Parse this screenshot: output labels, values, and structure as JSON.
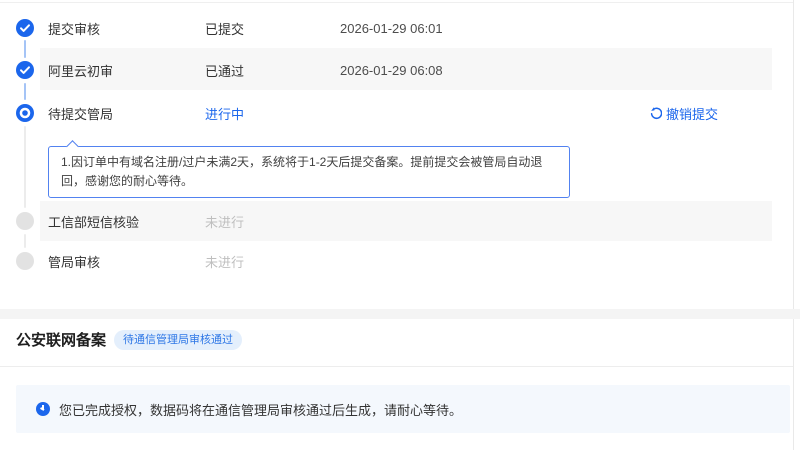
{
  "colors": {
    "accent_blue": "#1b66ec",
    "link_blue": "#2e77e6",
    "connector_blue": "#a5c4f6",
    "connector_gray": "#ececec",
    "row_alt_bg": "#f7f7f7",
    "pending_icon_gray": "#e2e2e2",
    "pending_text_gray": "#bfbfbf",
    "tooltip_border": "#5282f0",
    "badge_bg": "#e4effc",
    "info_bar_bg": "#f4f8fd"
  },
  "timeline": {
    "steps": [
      {
        "label": "提交审核",
        "status": "已提交",
        "time": "2026-01-29 06:01",
        "state": "done",
        "icon": "check-circle-icon"
      },
      {
        "label": "阿里云初审",
        "status": "已通过",
        "time": "2026-01-29 06:08",
        "state": "done",
        "icon": "check-circle-icon"
      },
      {
        "label": "待提交管局",
        "status": "进行中",
        "time": "",
        "state": "current",
        "icon": "radio-circle-icon",
        "action_label": "撤销提交",
        "action_icon": "undo-icon"
      },
      {
        "label": "工信部短信核验",
        "status": "未进行",
        "time": "",
        "state": "pending",
        "icon": "gray-dot-icon"
      },
      {
        "label": "管局审核",
        "status": "未进行",
        "time": "",
        "state": "pending",
        "icon": "gray-dot-icon"
      }
    ],
    "notice": "1.因订单中有域名注册/过户未满2天，系统将于1-2天后提交备案。提前提交会被管局自动退回，感谢您的耐心等待。"
  },
  "police_filing": {
    "title": "公安联网备案",
    "badge": "待通信管理局审核通过",
    "notice": "您已完成授权，数据码将在通信管理局审核通过后生成，请耐心等待。",
    "icon": "clock-icon"
  }
}
